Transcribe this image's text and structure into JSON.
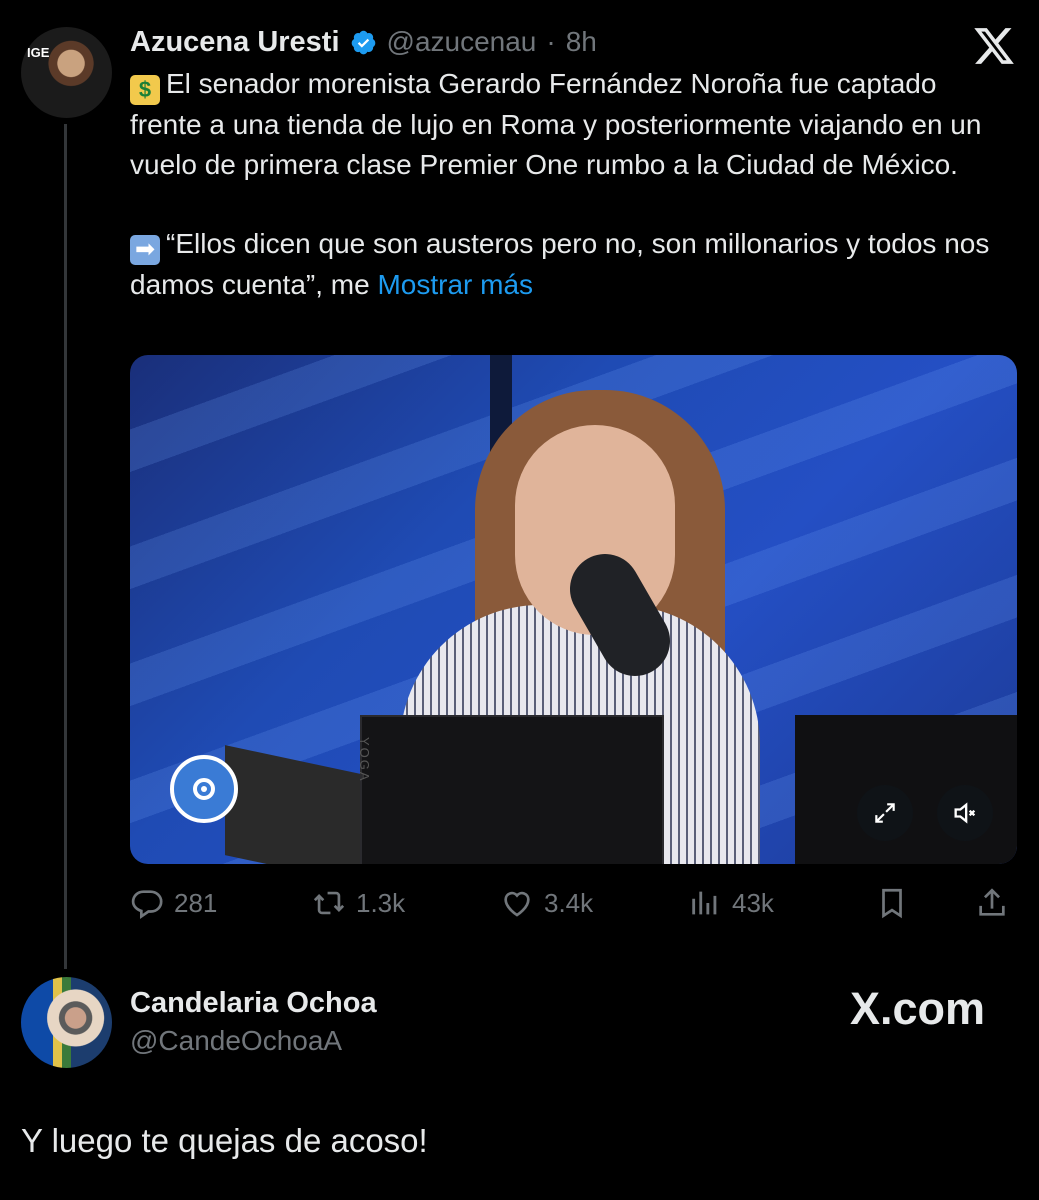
{
  "tweet": {
    "author_name": "Azucena Uresti",
    "author_handle": "@azucenau",
    "time": "8h",
    "separator": "·",
    "avatar_logo_text": "IGE",
    "text_line1_emoji": "money-bag",
    "text_paragraph1": "El senador morenista Gerardo Fernández Noroña fue captado frente a una tienda de lujo en Roma y posteriormente viajando en un vuelo de primera clase Premier One rumbo a la Ciudad de México.",
    "text_line2_emoji": "right-arrow",
    "text_paragraph2": "“Ellos dicen que son austeros pero no, son millonarios y todos nos damos cuenta”, me",
    "show_more": "Mostrar más",
    "media": {
      "laptop_brand": "YOGA"
    },
    "actions": {
      "replies": "281",
      "retweets": "1.3k",
      "likes": "3.4k",
      "views": "43k"
    }
  },
  "reply": {
    "author_name": "Candelaria Ochoa",
    "author_handle": "@CandeOchoaA",
    "text": "Y luego te quejas de acoso!"
  },
  "watermark": "X.com",
  "colors": {
    "background": "#000000",
    "text": "#e7e9ea",
    "muted": "#71767b",
    "link": "#1d9bf0",
    "verified": "#1d9bf0"
  },
  "icons": [
    "x-logo-icon",
    "verified-badge-icon",
    "reply-icon",
    "retweet-icon",
    "like-icon",
    "views-icon",
    "bookmark-icon",
    "share-icon",
    "expand-icon",
    "mute-icon"
  ]
}
